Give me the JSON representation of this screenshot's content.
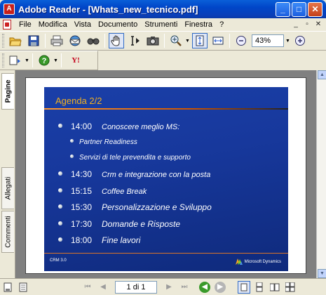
{
  "window": {
    "title": "Adobe Reader - [Whats_new_tecnico.pdf]",
    "app_icon": "acrobat-icon",
    "minimize_glyph": "_",
    "maximize_glyph": "□",
    "close_glyph": "✕"
  },
  "menu": {
    "items": [
      "File",
      "Modifica",
      "Vista",
      "Documento",
      "Strumenti",
      "Finestra",
      "?"
    ],
    "right_glyphs": [
      "_",
      "▫",
      "✕"
    ]
  },
  "toolbar": {
    "zoom_value": "43%",
    "icons": [
      "open-icon",
      "save-icon",
      "print-icon",
      "email-icon",
      "search-icon",
      "hand-icon",
      "select-text-icon",
      "snapshot-icon",
      "zoom-in-icon",
      "fit-page-icon",
      "fit-width-icon",
      "zoom-out-circle-icon",
      "zoom-in-circle-icon"
    ]
  },
  "toolbar2": {
    "icons": [
      "pages-icon",
      "help-icon",
      "yahoo-icon"
    ],
    "yahoo_label": "Y!"
  },
  "nav_panel": {
    "tabs": [
      "Pagine",
      "Allegati",
      "Commenti"
    ]
  },
  "slide": {
    "title": "Agenda 2/2",
    "rows": [
      {
        "time": "14:00",
        "desc": "Conoscere meglio MS:"
      },
      {
        "time": "14:30",
        "desc": "Crm e integrazione con la posta"
      },
      {
        "time": "15:15",
        "desc": "Coffee Break"
      },
      {
        "time": "15:30",
        "desc": "Personalizzazione e Sviluppo"
      },
      {
        "time": "17:30",
        "desc": "Domande e Risposte"
      },
      {
        "time": "18:00",
        "desc": "Fine lavori"
      }
    ],
    "subitems": [
      "Partner Readiness",
      "Servizi di tele prevendita e supporto"
    ],
    "footer_left": "CRM 3.0",
    "footer_right": "Microsoft Dynamics"
  },
  "statusbar": {
    "page_indicator": "1 di 1"
  },
  "colors": {
    "title_bar": "#0a5fd8",
    "slide_bg": "#1a3fa8",
    "slide_title": "#f2b020",
    "accent_line": "#ff9933"
  }
}
